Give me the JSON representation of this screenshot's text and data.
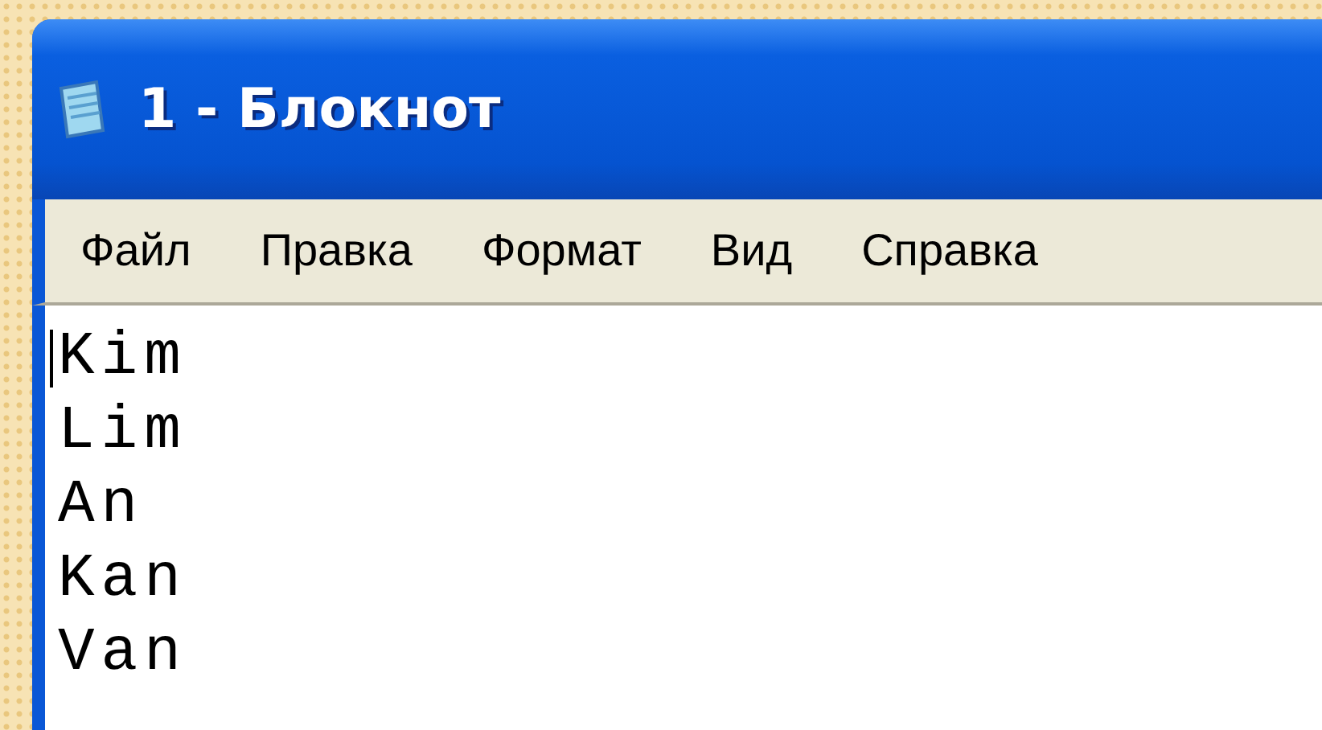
{
  "window": {
    "title": "1 - Блокнот"
  },
  "menu": [
    "Файл",
    "Правка",
    "Формат",
    "Вид",
    "Справка"
  ],
  "editor": {
    "lines": [
      "Kim",
      "Lim",
      "An",
      "Kan",
      "Van"
    ]
  }
}
